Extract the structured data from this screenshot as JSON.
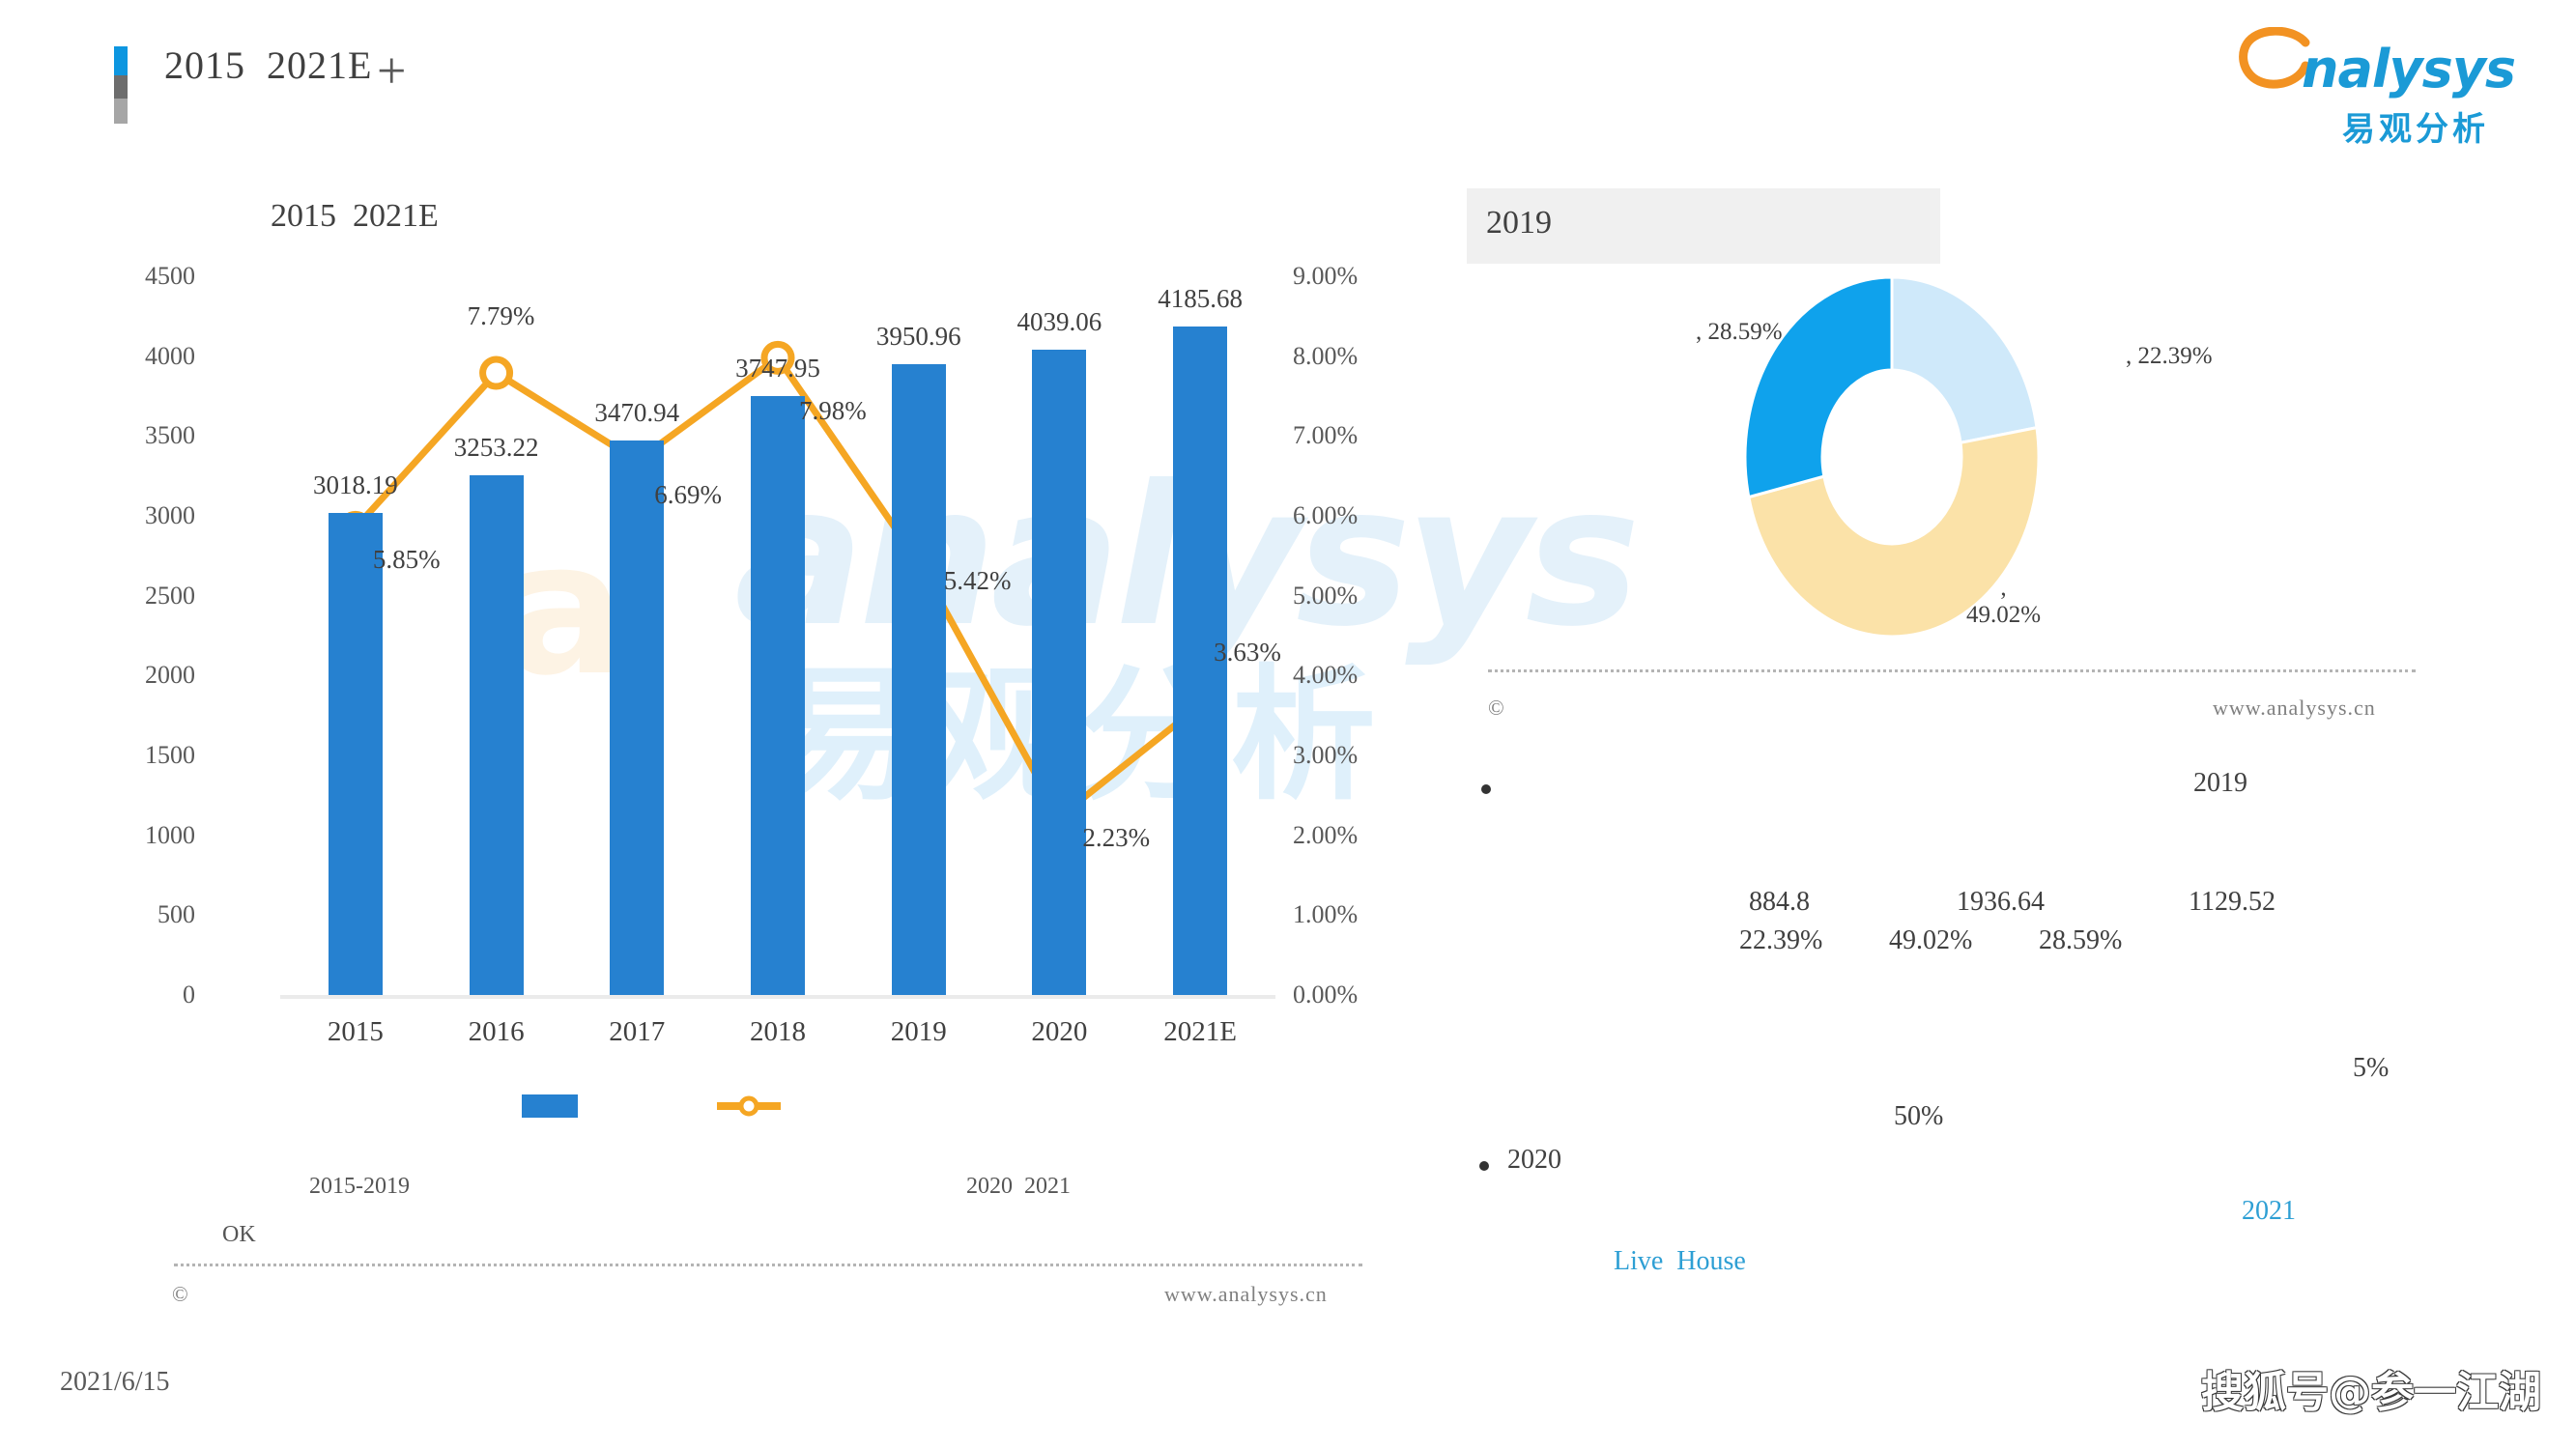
{
  "header": {
    "title": "2015  2021E",
    "plus_icon": "+",
    "accent_colors": [
      "#0d96e0",
      "#6d6d6d",
      "#a6a6a6"
    ]
  },
  "logo": {
    "wordmark": "nalysys",
    "cn_name": "易观分析",
    "mark_color": "#f29222",
    "word_color": "#1b9ad6"
  },
  "left_chart": {
    "chart_title": "2015  2021E",
    "legend": {
      "bar_label": "",
      "line_label": ""
    },
    "notes": {
      "note_left": "2015-2019",
      "note_right": "2020  2021",
      "ok": "OK"
    },
    "footer": {
      "copyright": "©",
      "url": "www.analysys.cn"
    }
  },
  "right_panel": {
    "donut_title": "2019",
    "footer": {
      "copyright": "©",
      "url": "www.analysys.cn"
    },
    "bullets": [
      {
        "marker": "•",
        "line1": "2019",
        "line2_a": "884.8",
        "line2_b": "1936.64",
        "line2_c": "1129.52",
        "line3_a": "22.39%",
        "line3_b": "49.02%",
        "line3_c": "28.59%"
      },
      {
        "marker": "•",
        "label": "2020",
        "pct_small": "5%",
        "pct_mid": "50%",
        "year_blue": "2021",
        "live_house": "Live  House"
      }
    ]
  },
  "watermarks": {
    "w1": "analysys",
    "w2": "易观分析",
    "w3": "a",
    "sohu": "搜狐号@参一江湖"
  },
  "date_stamp": "2021/6/15",
  "chart_data": [
    {
      "type": "bar",
      "title": "2015  2021E",
      "xlabel": "",
      "ylabel": "",
      "y2label": "",
      "categories": [
        "2015",
        "2016",
        "2017",
        "2018",
        "2019",
        "2020",
        "2021E"
      ],
      "ylim": [
        0,
        4500
      ],
      "yticks": [
        0,
        500,
        1000,
        1500,
        2000,
        2500,
        3000,
        3500,
        4000,
        4500
      ],
      "ytick_labels": [
        "0",
        "500",
        "1000",
        "1500",
        "2000",
        "2500",
        "3000",
        "3500",
        "4000",
        "4500"
      ],
      "y2lim": [
        0,
        9
      ],
      "y2ticks": [
        0,
        1,
        2,
        3,
        4,
        5,
        6,
        7,
        8,
        9
      ],
      "y2tick_labels": [
        "0.00%",
        "1.00%",
        "2.00%",
        "3.00%",
        "4.00%",
        "5.00%",
        "6.00%",
        "7.00%",
        "8.00%",
        "9.00%"
      ],
      "grid": false,
      "legend_position": "bottom",
      "series": [
        {
          "name": "",
          "kind": "bar",
          "axis": "left",
          "color": "#2681d0",
          "values": [
            3018.19,
            3253.22,
            3470.94,
            3747.95,
            3950.96,
            4039.06,
            4185.68
          ],
          "value_labels": [
            "3018.19",
            "3253.22",
            "3470.94",
            "3747.95",
            "3950.96",
            "4039.06",
            "4185.68"
          ]
        },
        {
          "name": "",
          "kind": "line",
          "axis": "right",
          "color": "#f5a623",
          "values": [
            5.85,
            7.79,
            6.69,
            7.98,
            5.42,
            2.23,
            3.63
          ],
          "value_labels": [
            "5.85%",
            "7.79%",
            "6.69%",
            "7.98%",
            "5.42%",
            "2.23%",
            "3.63%"
          ]
        }
      ]
    },
    {
      "type": "pie",
      "title": "2019",
      "donut": true,
      "labels": [
        "",
        "",
        ""
      ],
      "values": [
        22.39,
        49.02,
        28.59
      ],
      "value_labels": [
        ", 22.39%",
        ",\n49.02%",
        ", 28.59%"
      ],
      "colors": [
        "#cfe9fa",
        "#fbe2a8",
        "#0fa2ec"
      ],
      "absolute_values": [
        884.8,
        1936.64,
        1129.52
      ],
      "legend_position": "none"
    }
  ]
}
